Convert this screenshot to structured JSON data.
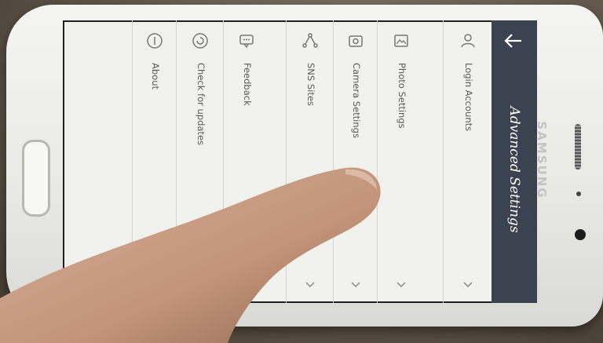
{
  "header": {
    "title": "Advanced Settings",
    "back_icon": "arrow-left-icon"
  },
  "menu": {
    "items": [
      {
        "label": "Login Accounts",
        "icon": "person-icon",
        "expandable": true
      },
      {
        "label": "Photo Settings",
        "icon": "image-icon",
        "expandable": true
      },
      {
        "label": "Camera Settings",
        "icon": "camera-icon",
        "expandable": true
      },
      {
        "label": "SNS Sites",
        "icon": "share-icon",
        "expandable": true
      },
      {
        "label": "Feedback",
        "icon": "chat-bubble-icon",
        "expandable": false
      },
      {
        "label": "Check for updates",
        "icon": "refresh-icon",
        "expandable": false
      },
      {
        "label": "About",
        "icon": "info-icon",
        "expandable": false
      }
    ]
  },
  "device": {
    "brand": "SAMSUNG"
  },
  "colors": {
    "app_bar": "#3c4350",
    "screen_bg": "#f1f1ee",
    "phone_body": "#ececea"
  }
}
